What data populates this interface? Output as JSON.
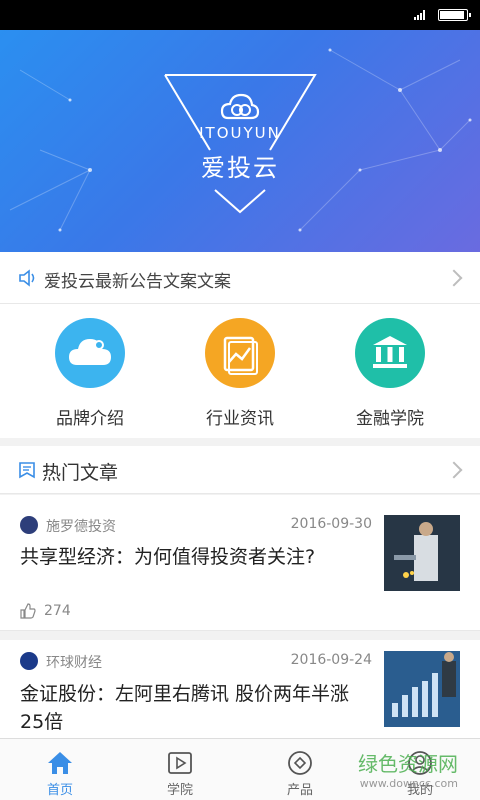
{
  "banner": {
    "title_en": "ITOUYUN",
    "title_cn": "爱投云"
  },
  "notice": {
    "text": "爱投云最新公告文案文案"
  },
  "features": [
    {
      "label": "品牌介绍",
      "color": "#3cb4ef"
    },
    {
      "label": "行业资讯",
      "color": "#f5a623"
    },
    {
      "label": "金融学院",
      "color": "#1fbfa8"
    }
  ],
  "hot": {
    "title": "热门文章"
  },
  "articles": [
    {
      "source": "施罗德投资",
      "date": "2016-09-30",
      "headline": "共享型经济：为何值得投资者关注?",
      "likes": "274"
    },
    {
      "source": "环球财经",
      "date": "2016-09-24",
      "headline": "金证股份：左阿里右腾讯 股价两年半涨25倍"
    }
  ],
  "nav": [
    {
      "label": "首页",
      "active": true
    },
    {
      "label": "学院"
    },
    {
      "label": "产品"
    },
    {
      "label": "我的"
    }
  ],
  "watermark": {
    "line1": "绿色资源网",
    "line2": "www.downcc.com"
  },
  "colors": {
    "accent": "#3a8ee6"
  }
}
